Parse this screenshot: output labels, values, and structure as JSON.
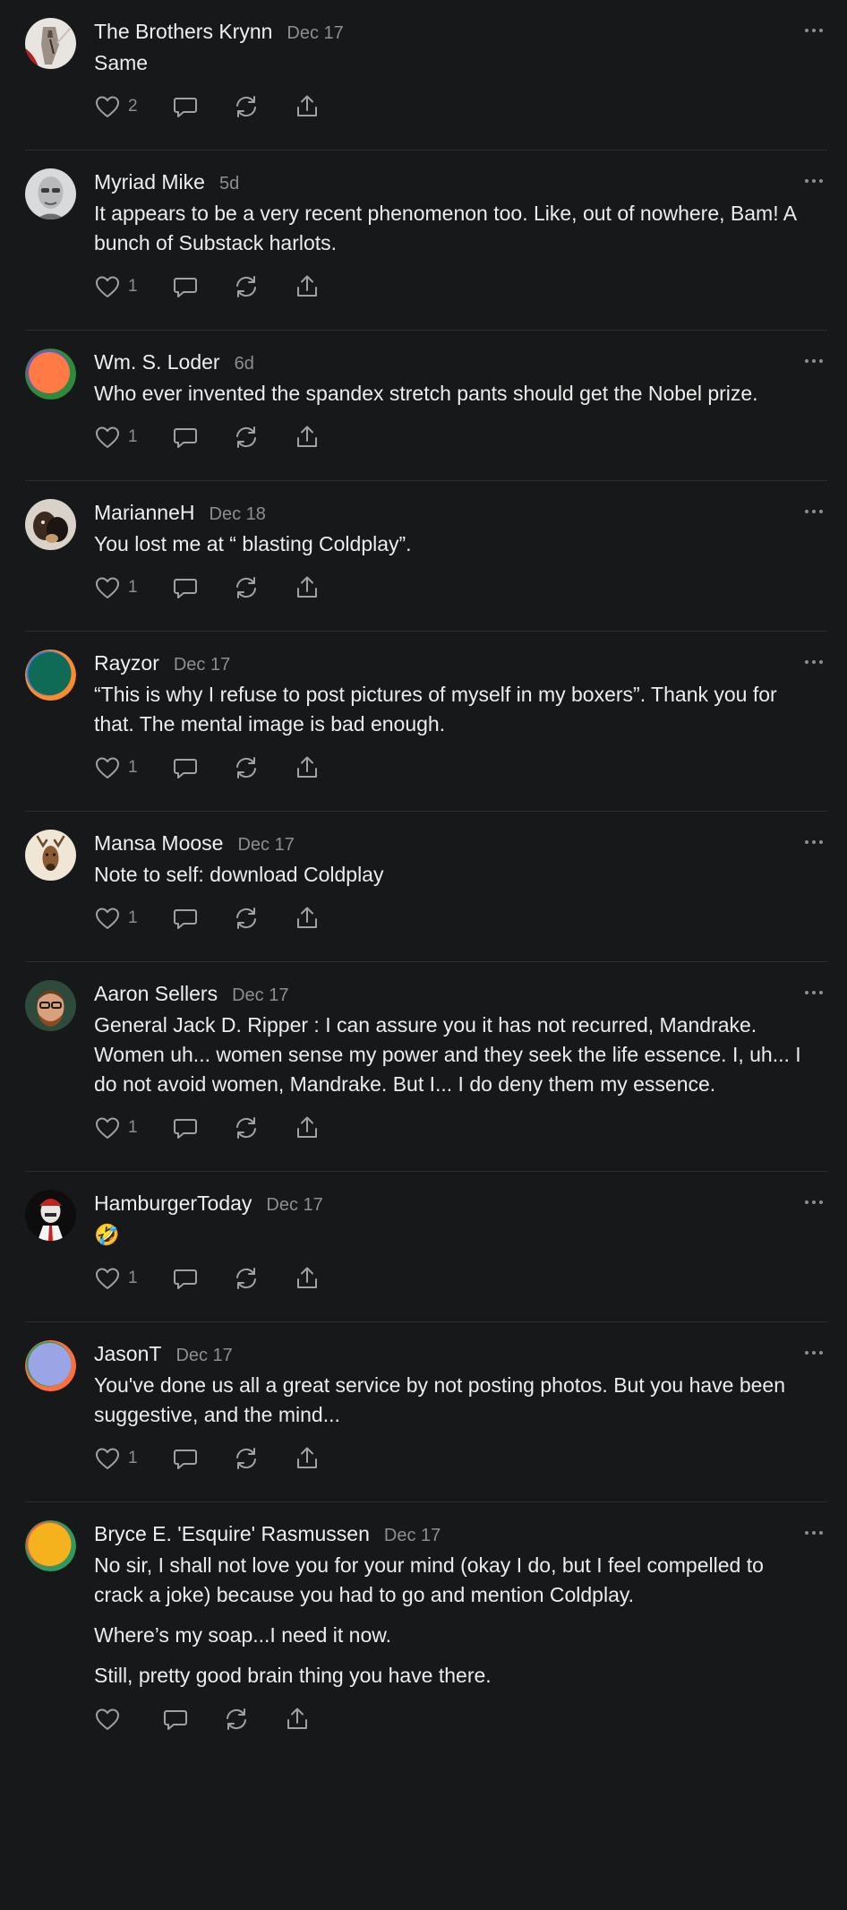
{
  "comments": [
    {
      "name": "The Brothers Krynn",
      "date": "Dec 17",
      "paragraphs": [
        "Same"
      ],
      "likes": "2"
    },
    {
      "name": "Myriad Mike",
      "date": "5d",
      "paragraphs": [
        "It appears to be a very recent phenomenon too. Like, out of nowhere, Bam! A bunch of Substack harlots."
      ],
      "likes": "1"
    },
    {
      "name": "Wm. S. Loder",
      "date": "6d",
      "paragraphs": [
        "Who ever invented the spandex stretch pants should get the Nobel prize."
      ],
      "likes": "1"
    },
    {
      "name": "MarianneH",
      "date": "Dec 18",
      "paragraphs": [
        "You lost me at “ blasting Coldplay”."
      ],
      "likes": "1"
    },
    {
      "name": "Rayzor",
      "date": "Dec 17",
      "paragraphs": [
        "“This is why I refuse to post pictures of myself in my boxers”. Thank you for that. The mental image is bad enough."
      ],
      "likes": "1"
    },
    {
      "name": "Mansa Moose",
      "date": "Dec 17",
      "paragraphs": [
        "Note to self: download Coldplay"
      ],
      "likes": "1"
    },
    {
      "name": "Aaron Sellers",
      "date": "Dec 17",
      "paragraphs": [
        "General Jack D. Ripper : I can assure you it has not recurred, Mandrake. Women uh... women sense my power and they seek the life essence. I, uh... I do not avoid women, Mandrake. But I... I do deny them my essence."
      ],
      "likes": "1"
    },
    {
      "name": "HamburgerToday",
      "date": "Dec 17",
      "paragraphs": [
        "🤣"
      ],
      "likes": "1"
    },
    {
      "name": "JasonT",
      "date": "Dec 17",
      "paragraphs": [
        "You've done us all a great service by not posting photos. But you have been suggestive, and the mind..."
      ],
      "likes": "1"
    },
    {
      "name": "Bryce E. 'Esquire' Rasmussen",
      "date": "Dec 17",
      "paragraphs": [
        "No sir, I shall not love you for your mind (okay I do, but I feel compelled to crack a joke) because you had to go and mention Coldplay.",
        "Where’s my soap...I need it now.",
        "Still, pretty good brain thing you have there."
      ],
      "likes": ""
    }
  ],
  "icons": {
    "like": "heart-icon",
    "reply": "comment-bubble-icon",
    "restack": "restack-icon",
    "share": "share-icon",
    "more": "more-dots-icon"
  },
  "colors": {
    "background": "#17181a",
    "divider": "#2c2d30",
    "text": "#ececec",
    "muted": "#8d8e92",
    "icon": "#a0a1a5"
  }
}
